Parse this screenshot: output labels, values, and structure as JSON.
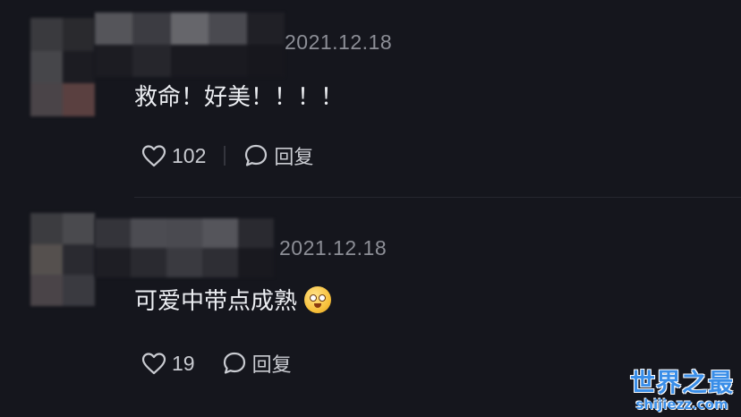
{
  "comments": [
    {
      "timestamp": "2021.12.18",
      "text": "救命！好美！！！！",
      "likes": "102",
      "reply_label": "回复"
    },
    {
      "timestamp": "2021.12.18",
      "text": "可爱中带点成熟",
      "emoji": "pleading-face-emoji",
      "likes": "19",
      "reply_label": "回复"
    }
  ],
  "watermark": {
    "title": "世界之最",
    "url": "shijiezz.com"
  },
  "colors": {
    "background": "#15161d",
    "timestamp": "#8c8e96",
    "text": "#eceef2",
    "watermark": "#3a8ee8"
  }
}
